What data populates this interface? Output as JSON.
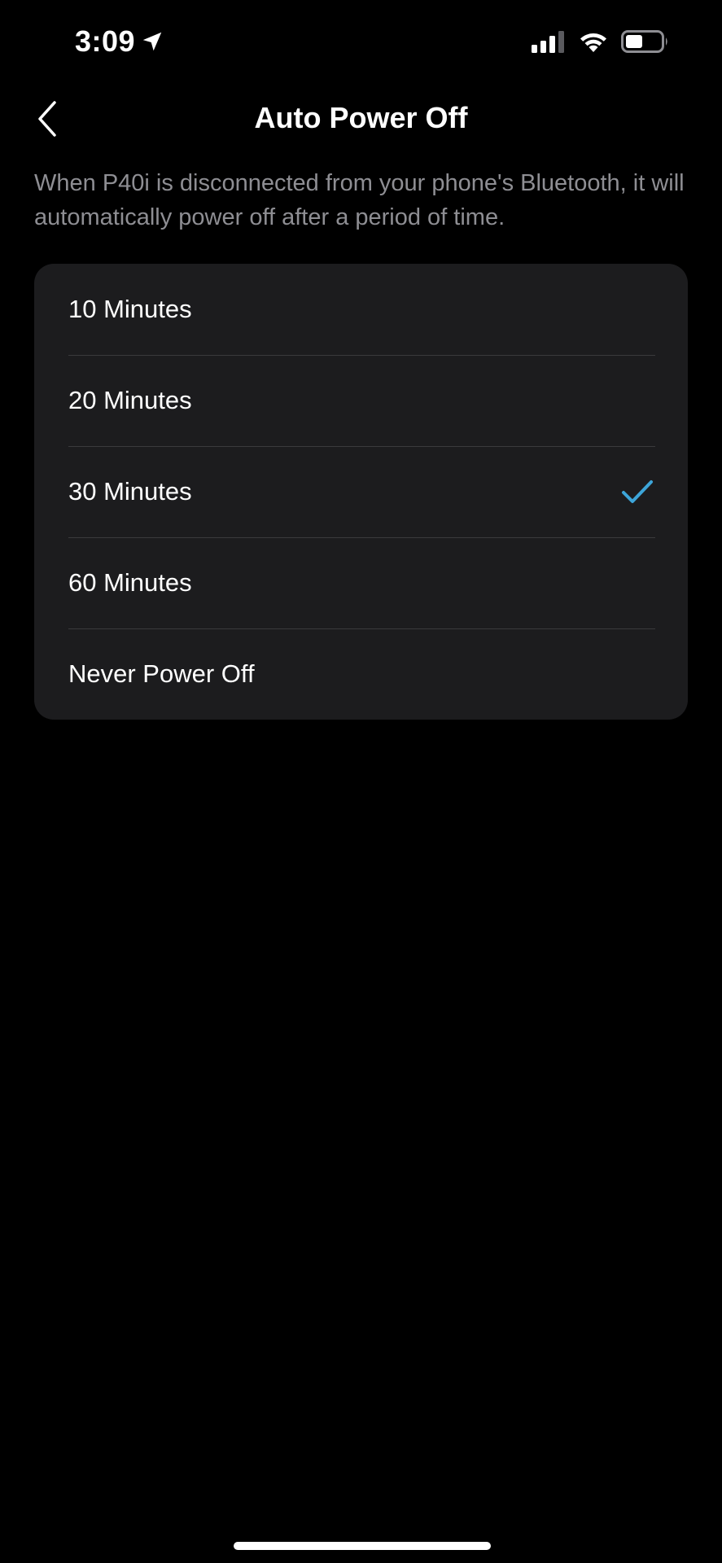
{
  "status_bar": {
    "time": "3:09",
    "location_icon": "location-arrow-icon",
    "signal_icon": "cellular-signal-icon",
    "wifi_icon": "wifi-icon",
    "battery_icon": "battery-icon"
  },
  "nav": {
    "back_icon": "chevron-left-icon",
    "title": "Auto Power Off"
  },
  "description": "When P40i is disconnected from your phone's Bluetooth, it will automatically power off after a period of time.",
  "options": [
    {
      "label": "10 Minutes",
      "selected": false
    },
    {
      "label": "20 Minutes",
      "selected": false
    },
    {
      "label": "30 Minutes",
      "selected": true
    },
    {
      "label": "60 Minutes",
      "selected": false
    },
    {
      "label": "Never Power Off",
      "selected": false
    }
  ],
  "colors": {
    "background": "#000000",
    "card": "#1c1c1e",
    "divider": "#3a3a3c",
    "secondary_text": "#8e8e93",
    "accent_check": "#3da5d9"
  }
}
